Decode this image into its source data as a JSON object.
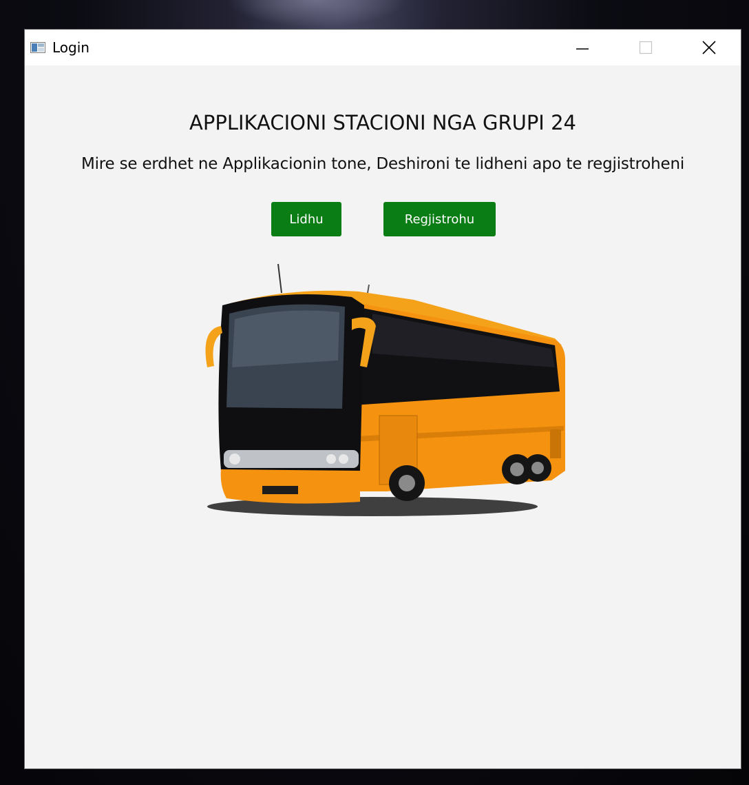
{
  "window": {
    "title": "Login",
    "icons": {
      "app": "app-window-icon",
      "minimize": "minimize-icon",
      "maximize": "maximize-icon",
      "close": "close-icon"
    }
  },
  "main": {
    "heading": "APPLIKACIONI STACIONI NGA GRUPI 24",
    "subheading": "Mire se erdhet ne Applikacionin tone, Deshironi te lidheni apo te regjistroheni",
    "buttons": {
      "login_label": "Lidhu",
      "register_label": "Regjistrohu"
    },
    "image": "bus-image"
  },
  "colors": {
    "button_bg": "#0a7d14",
    "window_bg": "#f3f3f3",
    "titlebar_bg": "#ffffff",
    "bus_body": "#f5920f"
  }
}
